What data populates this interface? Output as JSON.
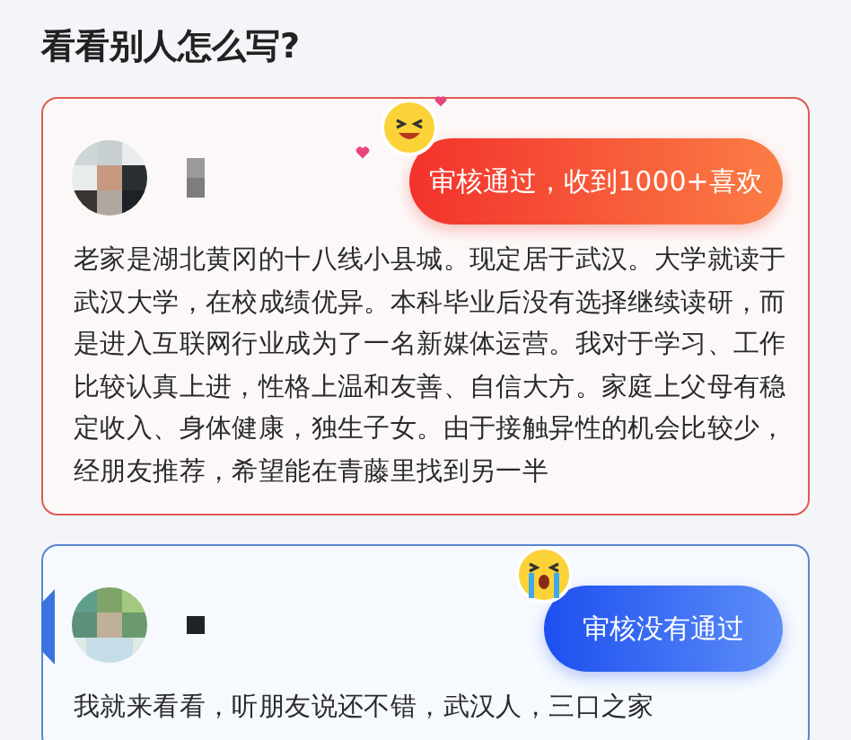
{
  "title": "看看别人怎么写?",
  "examples": [
    {
      "kind": "approved",
      "badge": "审核通过，收到1000+喜欢",
      "text": "老家是湖北黄冈的十八线小县城。现定居于武汉。大学就读于武汉大学，在校成绩优异。本科毕业后没有选择继续读研，而是进入互联网行业成为了一名新媒体运营。我对于学习、工作比较认真上进，性格上温和友善、自信大方。家庭上父母有稳定收入、身体健康，独生子女。由于接触异性的机会比较少，经朋友推荐，希望能在青藤里找到另一半"
    },
    {
      "kind": "rejected",
      "badge": "审核没有通过",
      "text": "我就来看看，听朋友说还不错，武汉人，三口之家"
    }
  ]
}
